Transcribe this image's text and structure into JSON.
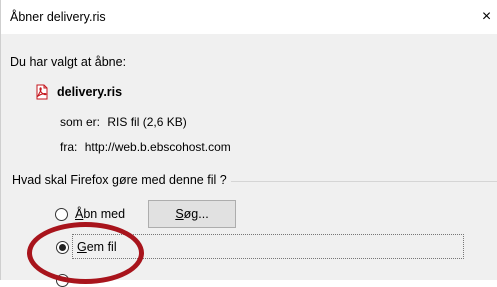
{
  "window": {
    "title": "Åbner delivery.ris",
    "close_glyph": "×"
  },
  "intro_text": "Du har valgt at åbne:",
  "file": {
    "icon": "pdf-file-icon",
    "name": "delivery.ris",
    "type_label": "som er:",
    "type_value": "RIS fil (2,6 KB)",
    "from_label": "fra:",
    "from_value": "http://web.b.ebscohost.com"
  },
  "action_group": {
    "title": "Hvad skal Firefox gøre med denne fil ?",
    "options": [
      {
        "label_mnemonic": "Å",
        "label_rest": "bn med",
        "selected": false
      },
      {
        "label_mnemonic": "G",
        "label_rest": "em fil",
        "selected": true
      }
    ],
    "search_button_mnemonic": "S",
    "search_button_rest": "øg..."
  },
  "colors": {
    "highlight_ring": "#a8141c",
    "dialog_body": "#f0f0f0"
  }
}
